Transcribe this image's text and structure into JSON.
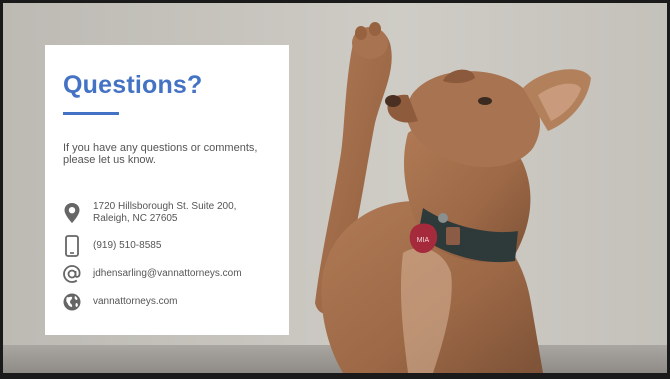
{
  "card": {
    "title": "Questions?",
    "intro": "If you have any questions or comments, please let us know."
  },
  "contacts": {
    "address_line1": "1720 Hillsborough St. Suite 200,",
    "address_line2": "Raleigh, NC 27605",
    "phone": "(919) 510-8585",
    "email": "jdhensarling@vannattorneys.com",
    "website": "vannattorneys.com"
  },
  "tag_text": "MIA",
  "colors": {
    "accent": "#4472c4",
    "text": "#555555",
    "icon": "#666666",
    "card": "#ffffff"
  },
  "icons": [
    "location-pin-icon",
    "phone-icon",
    "at-sign-icon",
    "globe-icon"
  ]
}
